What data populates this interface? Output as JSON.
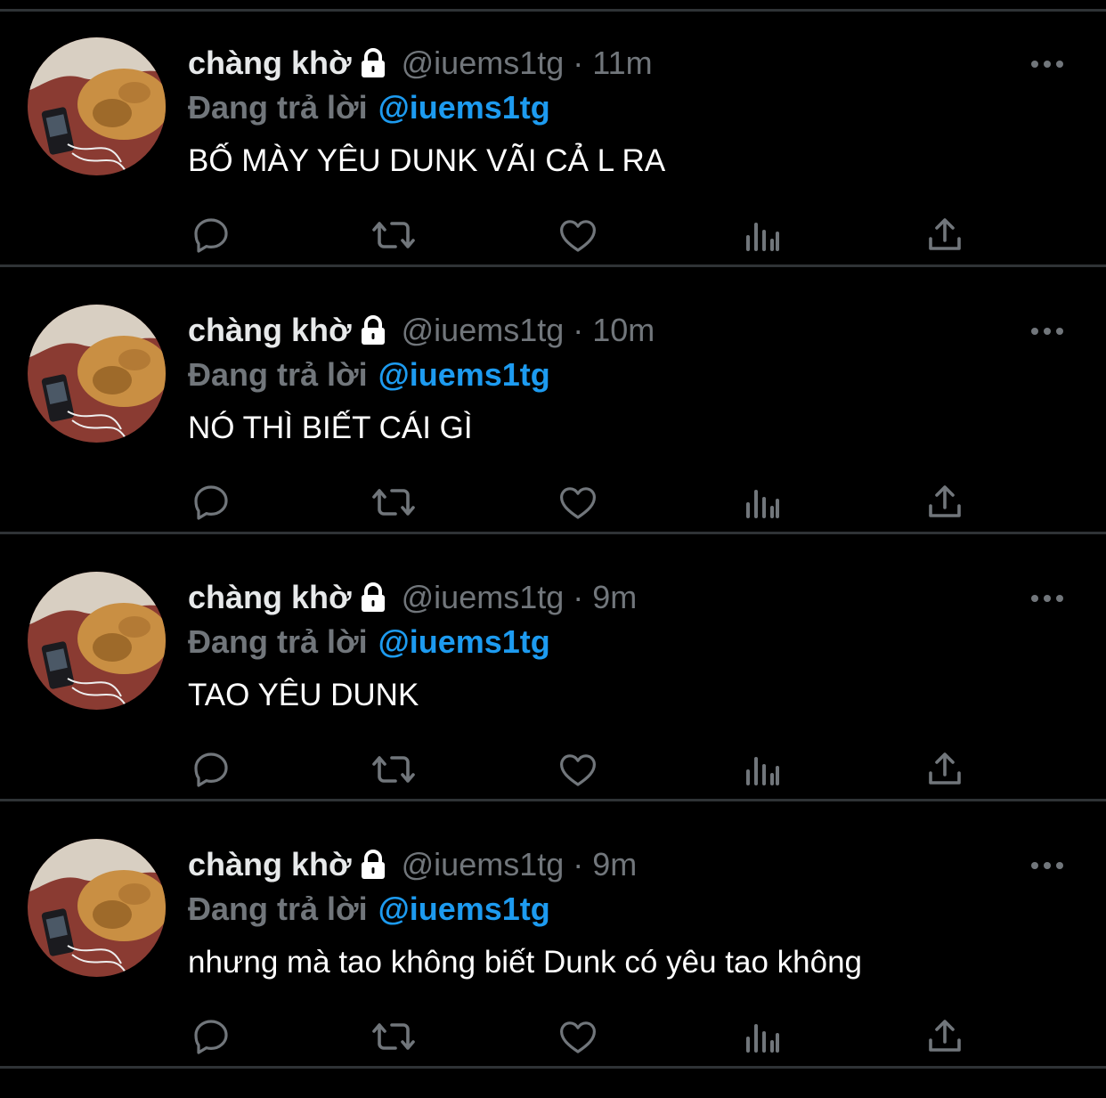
{
  "tweets": [
    {
      "author": "chàng khờ",
      "handle": "@iuems1tg",
      "separator": "·",
      "time": "11m",
      "reply_prefix": "Đang trả lời",
      "reply_to": "@iuems1tg",
      "text": "BỐ MÀY YÊU DUNK VÃI CẢ L RA"
    },
    {
      "author": "chàng khờ",
      "handle": "@iuems1tg",
      "separator": "·",
      "time": "10m",
      "reply_prefix": "Đang trả lời",
      "reply_to": "@iuems1tg",
      "text": "NÓ THÌ BIẾT CÁI GÌ"
    },
    {
      "author": "chàng khờ",
      "handle": "@iuems1tg",
      "separator": "·",
      "time": "9m",
      "reply_prefix": "Đang trả lời",
      "reply_to": "@iuems1tg",
      "text": "TAO YÊU DUNK"
    },
    {
      "author": "chàng khờ",
      "handle": "@iuems1tg",
      "separator": "·",
      "time": "9m",
      "reply_prefix": "Đang trả lời",
      "reply_to": "@iuems1tg",
      "text": "nhưng mà tao không biết Dunk có yêu tao không"
    }
  ],
  "icons": {
    "more": "more-horizontal-icon",
    "reply": "reply-icon",
    "retweet": "retweet-icon",
    "like": "like-icon",
    "views": "views-icon",
    "share": "share-icon",
    "lock": "lock-icon"
  },
  "colors": {
    "background": "#000000",
    "text": "#ffffff",
    "secondary": "#71767b",
    "accent": "#1d9bf0",
    "divider": "#2f3336"
  }
}
